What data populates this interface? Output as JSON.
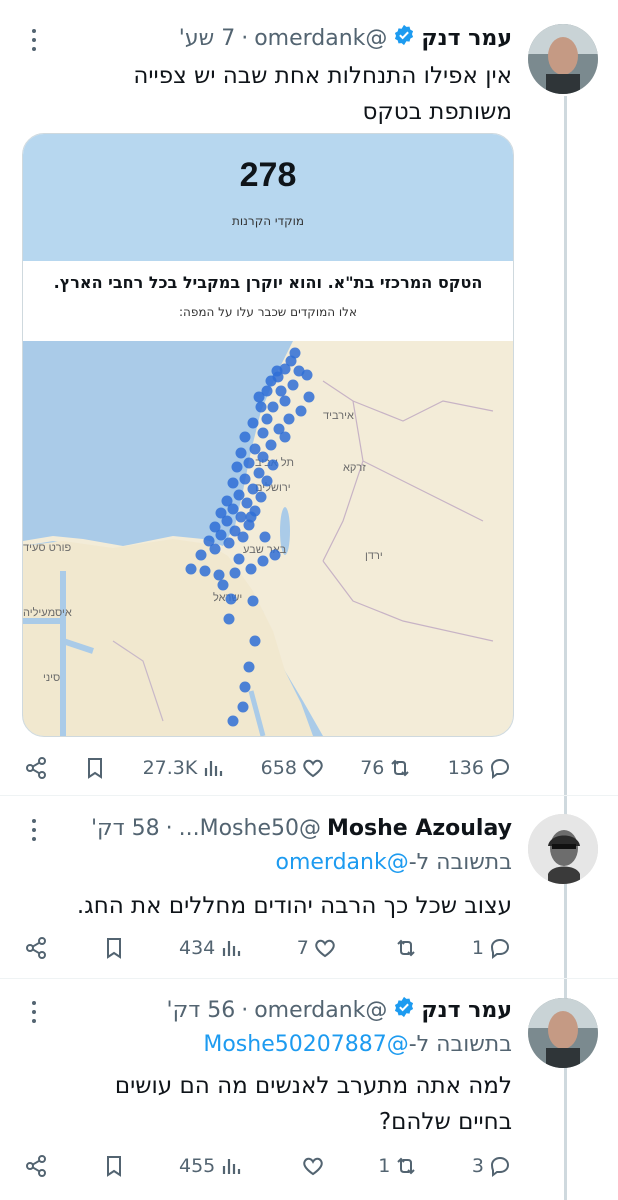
{
  "tweets": [
    {
      "name": "עמר דנק",
      "handle": "@omerdank",
      "time": "7 שע'",
      "verified": true,
      "text_lines": [
        "אין אפילו התנחלות אחת שבה יש צפייה",
        "משותפת בטקס"
      ],
      "card": {
        "count": "278",
        "count_label": "מוקדי הקרנות",
        "headline": "הטקס המרכזי בת\"א. והוא יוקרן במקביל בכל רחבי הארץ.",
        "subline": "אלו המוקדים שכבר עלו על המפה:",
        "map_labels": {
          "irbid": "אירביד",
          "tel_aviv": "תל אביב",
          "zarqa": "זרקא",
          "jerusalem": "ירושלים",
          "port_said": "פורט סעיד",
          "beersheba": "באר שבע",
          "jordan": "ירדן",
          "israel": "ישראל",
          "ismailia": "איסמעיליה",
          "sinai": "סיני"
        }
      },
      "actions": {
        "views": "27.3K",
        "likes": "658",
        "retweets": "76",
        "replies": "136"
      }
    },
    {
      "name": "Moshe Azoulay",
      "handle": "@Moshe50...",
      "time": "58 דק'",
      "reply_prefix": "בתשובה ל-",
      "reply_mention": "@omerdank",
      "text_lines": [
        "עצוב שכל כך הרבה יהודים מחללים את החג."
      ],
      "actions": {
        "views": "434",
        "likes": "7",
        "retweets": "",
        "replies": "1"
      }
    },
    {
      "name": "עמר דנק",
      "handle": "@omerdank",
      "time": "56 דק'",
      "verified": true,
      "reply_prefix": "בתשובה ל-",
      "reply_mention": "@Moshe50207887",
      "text_lines": [
        "למה אתה מתערב לאנשים מה הם עושים",
        "בחיים שלהם?"
      ],
      "actions": {
        "views": "455",
        "likes": "",
        "retweets": "1",
        "replies": "3"
      }
    }
  ],
  "colors": {
    "accent": "#1d9bf0",
    "muted": "#536471",
    "dots": "#2f6fd6",
    "sea": "#b7d7ef",
    "land": "#f3ecd8"
  }
}
